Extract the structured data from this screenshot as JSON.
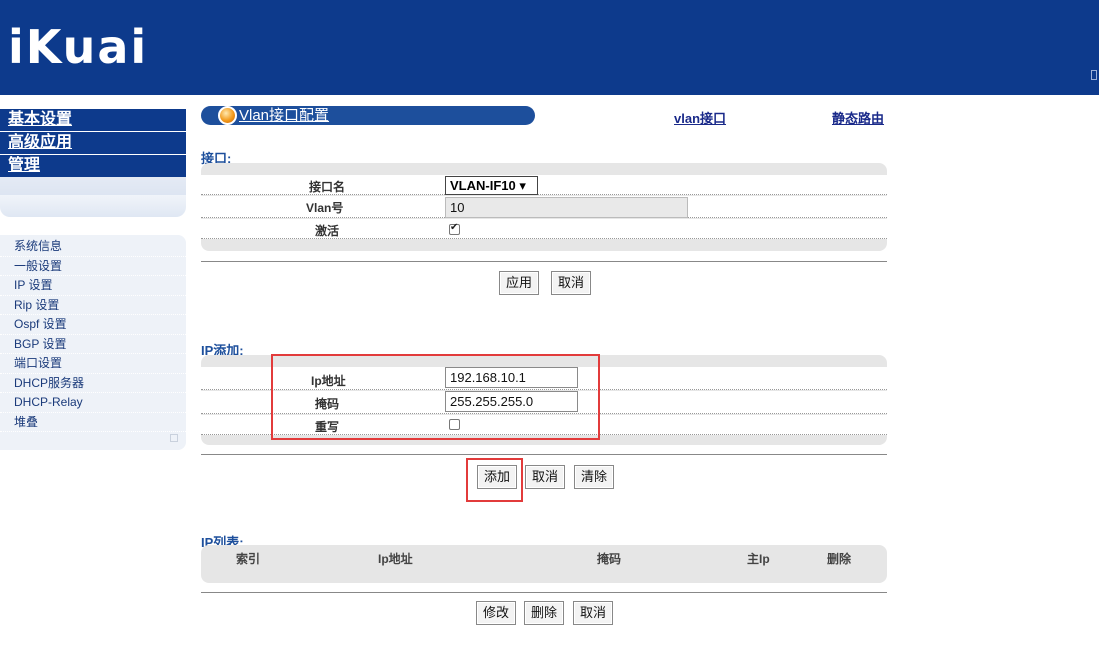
{
  "header": {
    "logo": "iKuai"
  },
  "sidebar": {
    "main_menu": [
      "基本设置",
      "高级应用",
      "管理"
    ],
    "sub_menu": [
      "系统信息",
      "一般设置",
      "IP 设置",
      "Rip 设置",
      "Ospf 设置",
      "BGP 设置",
      "端口设置",
      "DHCP服务器",
      "DHCP-Relay",
      "堆叠"
    ]
  },
  "page": {
    "title": "Vlan接口配置",
    "links": {
      "vlan_interface": "vlan接口",
      "static_route": "静态路由"
    }
  },
  "interface_section": {
    "title": "接口:",
    "name_label": "接口名",
    "name_value": "VLAN-IF10 ▾",
    "vlan_label": "Vlan号",
    "vlan_value": "10",
    "active_label": "激活",
    "active_checked": true,
    "apply_button": "应用",
    "cancel_button": "取消"
  },
  "ip_add_section": {
    "title": "IP添加:",
    "ip_label": "Ip地址",
    "ip_value": "192.168.10.1",
    "mask_label": "掩码",
    "mask_value": "255.255.255.0",
    "overwrite_label": "重写",
    "overwrite_checked": false,
    "add_button": "添加",
    "cancel_button": "取消",
    "clear_button": "清除"
  },
  "ip_list_section": {
    "title": "IP列表:",
    "columns": [
      "索引",
      "Ip地址",
      "掩码",
      "主Ip",
      "删除"
    ],
    "modify_button": "修改",
    "delete_button": "删除",
    "cancel_button": "取消"
  },
  "colors": {
    "header_bg": "#0d3a8c",
    "title_bar": "#1d4f9c",
    "highlight": "#e23b3b"
  }
}
